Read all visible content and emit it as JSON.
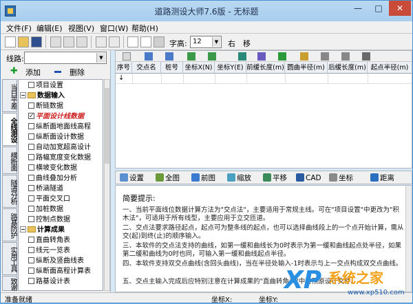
{
  "window": {
    "title": "道路测设大师7.6版 - 无标题",
    "min_label": "—",
    "max_label": "□",
    "close_label": "✕"
  },
  "menu": [
    "文件(F)",
    "编辑(E)",
    "视图(V)",
    "窗口(W)",
    "帮助(H)"
  ],
  "toolbar": {
    "font_label": "字高:",
    "font_size": "12",
    "right_label": "右",
    "move_label": "移"
  },
  "left": {
    "route_label": "线路:",
    "route_value": "",
    "add_label": "添加",
    "delete_label": "删除",
    "vtabs": [
      "当日平差",
      "全线测设",
      "横断面",
      "隧道分析",
      "路基防护",
      "实用工具",
      "致谢"
    ],
    "tree": [
      {
        "label": "项目设置",
        "type": "check",
        "level": 1
      },
      {
        "label": "数据输入",
        "type": "folder",
        "level": 0,
        "bold": true
      },
      {
        "label": "断链数据",
        "type": "check",
        "level": 1
      },
      {
        "label": "平面设计线数据",
        "type": "check",
        "level": 1,
        "checked": true,
        "red": true
      },
      {
        "label": "纵断面地面线高程",
        "type": "check",
        "level": 1
      },
      {
        "label": "纵断面设计数据",
        "type": "check",
        "level": 1
      },
      {
        "label": "自动加宽超高设计",
        "type": "check",
        "level": 1
      },
      {
        "label": "路幅宽度变化数据",
        "type": "check",
        "level": 1
      },
      {
        "label": "横坡变化数据",
        "type": "check",
        "level": 1
      },
      {
        "label": "曲线叠加分析",
        "type": "check",
        "level": 1
      },
      {
        "label": "桥涵隧道",
        "type": "check",
        "level": 1
      },
      {
        "label": "平面交叉口",
        "type": "check",
        "level": 1
      },
      {
        "label": "加桩数据",
        "type": "check",
        "level": 1
      },
      {
        "label": "控制点数据",
        "type": "check",
        "level": 1
      },
      {
        "label": "计算成果",
        "type": "folder",
        "level": 0,
        "bold": true
      },
      {
        "label": "直曲转角表",
        "type": "check",
        "level": 1
      },
      {
        "label": "线元一览表",
        "type": "check",
        "level": 1
      },
      {
        "label": "纵断及竖曲线表",
        "type": "check",
        "level": 1
      },
      {
        "label": "纵断面高程计算表",
        "type": "check",
        "level": 1
      },
      {
        "label": "路基设计表",
        "type": "check",
        "level": 1
      }
    ]
  },
  "grid": {
    "columns": [
      "序号",
      "交点名",
      "桩号",
      "坐标X(N)",
      "坐标Y(E)",
      "前缓长度(m)",
      "圆曲半径(m)",
      "后缓长度(m)",
      "起点半径(m)"
    ],
    "row_marker": "↓"
  },
  "graphics_toolbar": [
    {
      "icon": "settings-icon",
      "label": "设置",
      "color": "#5a8fd0"
    },
    {
      "icon": "full-view-icon",
      "label": "全图",
      "color": "#6a9a3a"
    },
    {
      "icon": "previous-view-icon",
      "label": "前图",
      "color": "#3a7ad0"
    },
    {
      "icon": "zoom-icon",
      "label": "缩放",
      "color": "#4aa0c0"
    },
    {
      "icon": "pan-icon",
      "label": "平移",
      "color": "#3a8a5a"
    },
    {
      "icon": "cad-icon",
      "label": "CAD",
      "color": "#2a5aa0"
    },
    {
      "icon": "coordinate-icon",
      "label": "坐标",
      "color": "#8a8a8a"
    },
    {
      "icon": "distance-icon",
      "label": "距离",
      "color": "#2a70c0"
    }
  ],
  "info": {
    "heading": "简要提示:",
    "paragraphs": [
      "一、当前平面线位数据计算方法为\"交点法\"，主要适用于常规主线。可在\"项目设置\"中更改为\"积木法\"，可适用于所有线型，主要应用于立交匝道。",
      "二、交点法要求路径起点，起点可为整条线的起点，也可以选择曲线段上的一个点开始计算，需从交(起)到终(止)的顺序输入。",
      "三、本软件的交点法支持的曲线，如第一缓和曲线长为0时表示为第一缓和曲线起点处半径，如果第二缓和曲线为0时也同，可输入第一缓和曲线起点半径。",
      "四、本软件支持双交点曲线(含回头曲线)，当在半径处输入-1时表示与上一交点构成双交点曲线。",
      "五、交点主输入完成后应特别注意在计算成果的\"直曲转角表\"中对照原设计文件。"
    ]
  },
  "status": {
    "ready": "准备就绪",
    "x_label": "坐标X:",
    "y_label": "坐标Y:"
  },
  "watermark": {
    "xp": "XP",
    "name": "系统之家",
    "url": "www.xp510.com"
  }
}
